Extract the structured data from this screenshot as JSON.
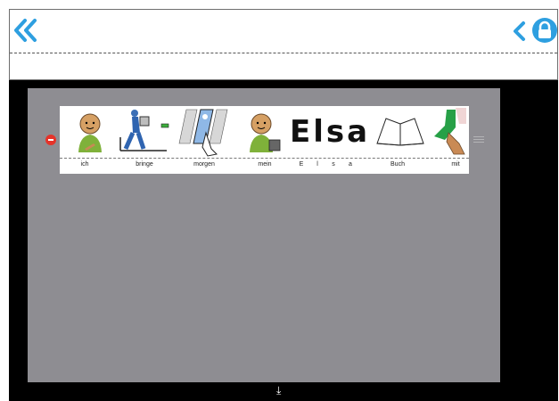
{
  "header": {
    "back_all_icon": "double-chevron-left-icon",
    "back_icon": "chevron-left-icon",
    "lock_icon": "lock-icon",
    "accent_color": "#2e9fe0"
  },
  "sentence": {
    "words": [
      {
        "label": "ich",
        "symbol": "person-pointing-self"
      },
      {
        "label": "bringe",
        "symbol": "person-carrying-box"
      },
      {
        "label": "morgen",
        "symbol": "tomorrow-sun-calendar"
      },
      {
        "label": "mein",
        "symbol": "person-pointing-own"
      },
      {
        "label": "E",
        "symbol": "letter"
      },
      {
        "label": "l",
        "symbol": "letter"
      },
      {
        "label": "s",
        "symbol": "letter"
      },
      {
        "label": "a",
        "symbol": "letter"
      },
      {
        "label": "Buch",
        "symbol": "open-book"
      },
      {
        "label": "mit",
        "symbol": "hand-holding-sock"
      }
    ],
    "name_text": "Elsa"
  },
  "actions": {
    "remove_icon": "minus-circle-icon",
    "drag_icon": "drag-handle-icon",
    "scroll_down_icon": "arrow-down-to-line-icon",
    "scroll_down_glyph": "⤓"
  }
}
